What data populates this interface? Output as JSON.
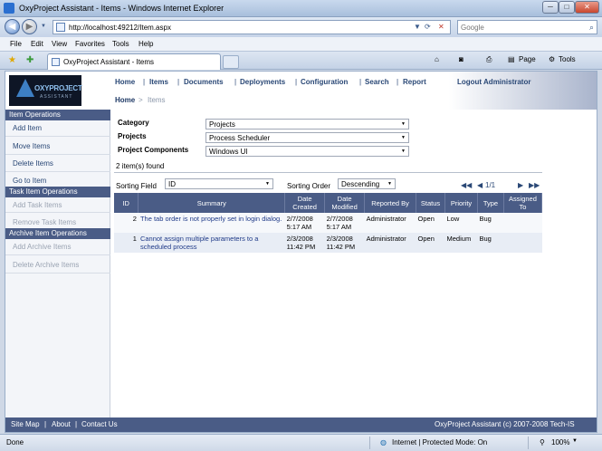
{
  "window": {
    "title": "OxyProject Assistant - Items - Windows Internet Explorer",
    "min": "─",
    "max": "□",
    "close": "✕"
  },
  "address": {
    "url": "http://localhost:49212/Item.aspx",
    "search_placeholder": "Google"
  },
  "menu": [
    "File",
    "Edit",
    "View",
    "Favorites",
    "Tools",
    "Help"
  ],
  "tab": {
    "label": "OxyProject Assistant - Items"
  },
  "toolbar": {
    "page": "Page",
    "tools": "Tools"
  },
  "logo": {
    "name": "OXYPROJECT",
    "sub": "ASSISTANT"
  },
  "nav": {
    "items": [
      "Home",
      "Items",
      "Documents",
      "Deployments",
      "Configuration",
      "Search",
      "Report"
    ],
    "logout": "Logout Administrator"
  },
  "breadcrumb": {
    "home": "Home",
    "sep": ">",
    "current": "Items"
  },
  "sidebar": {
    "item_ops": {
      "header": "Item Operations",
      "items": [
        "Add Item",
        "Move Items",
        "Delete Items",
        "Go to Item"
      ]
    },
    "task_ops": {
      "header": "Task Item Operations",
      "items": [
        "Add Task Items",
        "Remove Task Items"
      ]
    },
    "archive_ops": {
      "header": "Archive Item Operations",
      "items": [
        "Add Archive Items",
        "Delete Archive Items"
      ]
    }
  },
  "filters": {
    "category_label": "Category",
    "category_value": "Projects",
    "projects_label": "Projects",
    "projects_value": "Process Scheduler",
    "components_label": "Project Components",
    "components_value": "Windows UI"
  },
  "found": "2 item(s) found",
  "sorting": {
    "field_label": "Sorting Field",
    "field_value": "ID",
    "order_label": "Sorting Order",
    "order_value": "Descending"
  },
  "pager": {
    "first": "◀◀",
    "prev": "◀",
    "page": "1/1",
    "next": "▶",
    "last": "▶▶"
  },
  "table": {
    "headers": [
      "ID",
      "Summary",
      "Date Created",
      "Date Modified",
      "Reported By",
      "Status",
      "Priority",
      "Type",
      "Assigned To"
    ],
    "rows": [
      [
        "2",
        "The tab order is not properly set in login dialog.",
        "2/7/2008 5:17 AM",
        "2/7/2008 5:17 AM",
        "Administrator",
        "Open",
        "Low",
        "Bug",
        ""
      ],
      [
        "1",
        "Cannot assign multiple parameters to a scheduled process",
        "2/3/2008 11:42 PM",
        "2/3/2008 11:42 PM",
        "Administrator",
        "Open",
        "Medium",
        "Bug",
        ""
      ]
    ]
  },
  "footer": {
    "site_map": "Site Map",
    "about": "About",
    "contact": "Contact Us",
    "sep": "|",
    "copyright": "OxyProject Assistant (c) 2007-2008 Tech-IS"
  },
  "status": {
    "left": "Done",
    "zone": "Internet | Protected Mode: On",
    "zoom": "100%"
  }
}
